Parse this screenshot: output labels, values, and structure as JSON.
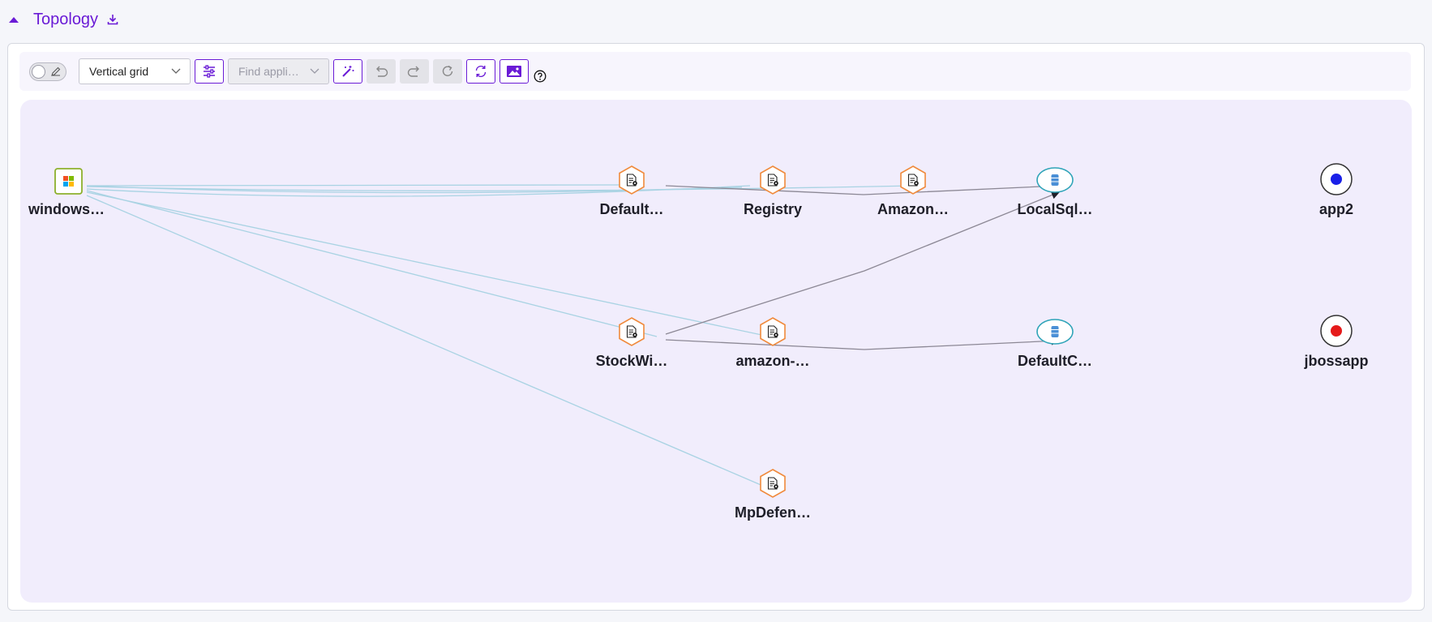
{
  "header": {
    "title": "Topology"
  },
  "toolbar": {
    "layout_select": "Vertical grid",
    "find_placeholder": "Find appli…"
  },
  "nodes": {
    "windows": "windows…",
    "default_app": "Default…",
    "registry": "Registry",
    "amazon_app": "Amazon…",
    "localsql": "LocalSql…",
    "app2": "app2",
    "stockwi": "StockWi…",
    "amazon_dash": "amazon-…",
    "defaultc": "DefaultC…",
    "jbossapp": "jbossapp",
    "mpdefen": "MpDefen…"
  },
  "colors": {
    "accent": "#6a1bd6",
    "service_node": "#f08a3c",
    "database_node": "#2fa4b8",
    "app2_status": "#1a20e8",
    "jbossapp_status": "#e51a1a",
    "host_node": "#8db02c",
    "light_edge": "#a9d3e3",
    "dark_edge": "#8c8895"
  },
  "icons": [
    "export-icon",
    "pencil-icon",
    "filter-settings-icon",
    "magic-wand-icon",
    "undo-icon",
    "redo-icon",
    "reload-icon",
    "refresh-icon",
    "image-export-icon",
    "help-icon",
    "windows-icon",
    "service-file-icon",
    "database-icon"
  ]
}
